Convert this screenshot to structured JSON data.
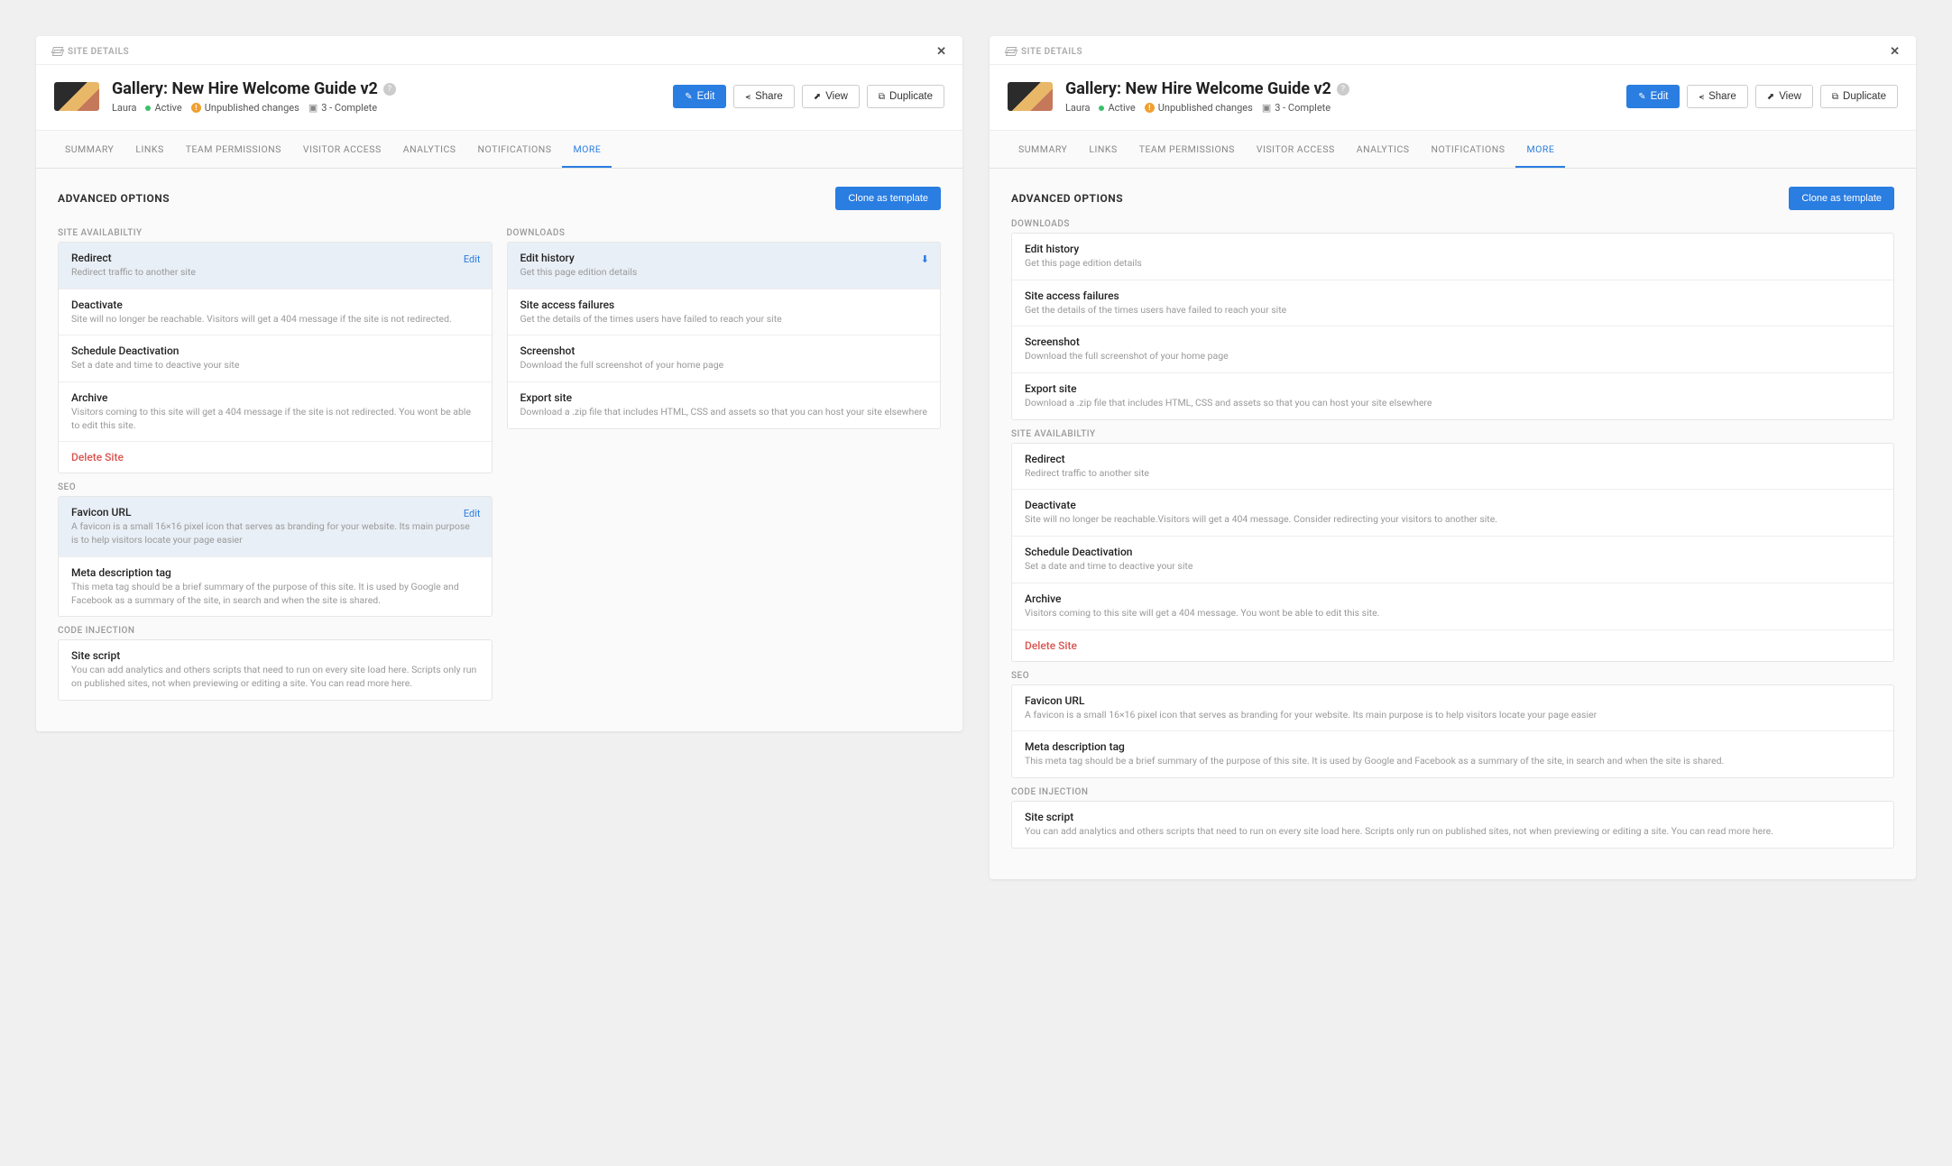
{
  "header": {
    "breadcrumb": "SITE DETAILS",
    "title": "Gallery: New Hire Welcome Guide v2",
    "author": "Laura",
    "status": "Active",
    "unpublished": "Unpublished changes",
    "complete": "3 - Complete"
  },
  "actions": {
    "edit": "Edit",
    "share": "Share",
    "view": "View",
    "duplicate": "Duplicate"
  },
  "nav": {
    "summary": "SUMMARY",
    "links": "LINKS",
    "team": "TEAM PERMISSIONS",
    "visitor": "VISITOR ACCESS",
    "analytics": "ANALYTICS",
    "notifications": "NOTIFICATIONS",
    "more": "MORE"
  },
  "advanced": {
    "title": "ADVANCED OPTIONS",
    "clone": "Clone as template"
  },
  "sections": {
    "availability": "SITE AVAILABILTIY",
    "downloads": "DOWNLOADS",
    "seo": "SEO",
    "code": "CODE INJECTION"
  },
  "left": {
    "availability": {
      "redirect": {
        "title": "Redirect",
        "desc": "Redirect traffic to another site",
        "action": "Edit"
      },
      "deactivate": {
        "title": "Deactivate",
        "desc": "Site will no longer be reachable. Visitors will get a 404 message if the site is not redirected."
      },
      "schedule": {
        "title": "Schedule Deactivation",
        "desc": "Set a date and time to deactive your site"
      },
      "archive": {
        "title": "Archive",
        "desc": "Visitors coming to this site will get a 404 message if the site is not redirected. You wont be able to edit this site."
      },
      "delete": {
        "title": "Delete Site"
      }
    },
    "downloads": {
      "history": {
        "title": "Edit history",
        "desc": "Get this page edition details"
      },
      "failures": {
        "title": "Site access failures",
        "desc": "Get the details of the times users have failed to reach your site"
      },
      "screenshot": {
        "title": "Screenshot",
        "desc": "Download the full screenshot of your home page"
      },
      "export": {
        "title": "Export site",
        "desc": "Download a .zip file that includes HTML, CSS and assets so that you can host your site elsewhere"
      }
    },
    "seo": {
      "favicon": {
        "title": "Favicon URL",
        "desc": " A favicon is a small 16×16 pixel icon that serves as branding for your website. Its main purpose is to help visitors locate your page easier",
        "action": "Edit"
      },
      "meta": {
        "title": "Meta description tag",
        "desc": "This meta tag should be a brief summary of the purpose of this site. It is used by Google and Facebook as a summary of the site, in search and when the site is shared."
      }
    },
    "code": {
      "script": {
        "title": "Site script",
        "desc": "You can add analytics and others scripts that need to run on every site load here. Scripts only run on published sites, not when previewing or editing a site. You can read more here."
      }
    }
  },
  "right": {
    "availability": {
      "redirect": {
        "title": "Redirect",
        "desc": "Redirect traffic to another site"
      },
      "deactivate": {
        "title": "Deactivate",
        "desc": "Site will no longer be reachable.Visitors will get a 404 message. Consider redirecting your visitors to another site."
      },
      "schedule": {
        "title": "Schedule Deactivation",
        "desc": "Set a date and time to deactive your site"
      },
      "archive": {
        "title": "Archive",
        "desc": "Visitors coming to this site will get a 404 message. You wont be able to edit this site."
      },
      "delete": {
        "title": "Delete Site"
      }
    }
  }
}
